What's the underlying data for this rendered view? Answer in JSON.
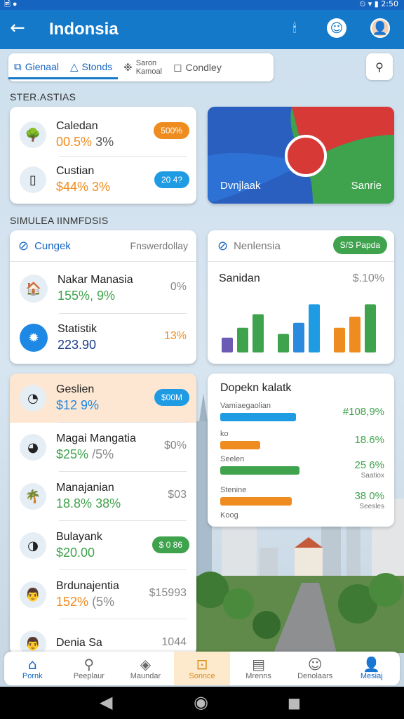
{
  "status": {
    "left": "🖻 ●",
    "right": "⏲ ▾ ▮ 2:50"
  },
  "appbar": {
    "back_icon": "←",
    "title": "Indonsia",
    "battery_icon": "🕯",
    "face_icon": "☺",
    "avatar_icon": "👤"
  },
  "tabs": [
    {
      "icon": "⧉",
      "label": "Gienaal"
    },
    {
      "icon": "△",
      "label": "Stonds"
    },
    {
      "icon": "❉",
      "label_line1": "Saron",
      "label_line2": "Kamoal"
    },
    {
      "icon": "◻",
      "label": "Condley"
    }
  ],
  "search_icon": "⚲",
  "section1": "STER.ASTIAS",
  "stats_card": {
    "rows": [
      {
        "label": "Caledan",
        "value": "00.5%",
        "value2": "3%",
        "badge": "500%",
        "badge_color": "#ef8c1f",
        "icon": "🌳"
      },
      {
        "label": "Custian",
        "value": "$44% 3%",
        "badge": "20 4?",
        "badge_color": "#1e9be3",
        "icon": "▯"
      }
    ]
  },
  "map_card": {
    "left_label": "Dvnjlaak",
    "right_label": "Sanrie",
    "colors": {
      "blue": "#2a5fc0",
      "red": "#d73a36",
      "green": "#3fa34d"
    }
  },
  "section2": "SIMULEA IINMFDSIS",
  "mid_left_card": {
    "header_icon": "⊘",
    "header_label": "Cungek",
    "header_right": "Fnswerdollay",
    "rows": [
      {
        "label": "Nakar Manasia",
        "value": "155%, 9%",
        "right": "0%",
        "icon": "🏠"
      },
      {
        "label": "Statistik",
        "value": "223.90",
        "right": "13%",
        "icon": "✹"
      }
    ]
  },
  "mid_right_card": {
    "header_icon": "⊘",
    "header_label": "Nenlensia",
    "header_pill": "S/S Papda",
    "chart_label": "Sanidan",
    "chart_right": "$.10%"
  },
  "bar_chart": {
    "type": "bar",
    "groups": [
      {
        "values": [
          24,
          40,
          62
        ],
        "colors": [
          "#6b5bb5",
          "#3fa34d",
          "#3fa34d"
        ]
      },
      {
        "values": [
          30,
          48,
          78
        ],
        "colors": [
          "#3fa34d",
          "#2a8ae0",
          "#1e9be3"
        ]
      },
      {
        "values": [
          40,
          58,
          78
        ],
        "colors": [
          "#ef8c1f",
          "#ef8c1f",
          "#3fa34d"
        ]
      }
    ],
    "ylim": [
      0,
      100
    ]
  },
  "list_card": {
    "rows": [
      {
        "label": "Geslien",
        "value": "$12 9%",
        "badge": "$00M",
        "badge_color": "#1e9be3",
        "icon": "◔",
        "highlight": true
      },
      {
        "label": "Magai Mangatia",
        "value": "$25%",
        "value2": "/5%",
        "right": "$0%",
        "icon": "◕"
      },
      {
        "label": "Manajanian",
        "value": "18.8%",
        "value2": "38%",
        "right": "$03",
        "icon": "🌴"
      },
      {
        "label": "Bulayank",
        "value": "$20.00",
        "badge": "$ 0 86",
        "badge_color": "#3fa34d",
        "icon": "◑"
      },
      {
        "label": "Brdunajentia",
        "value": "152%",
        "value2": "(5%",
        "right": "$15993",
        "icon": "👨"
      },
      {
        "label": "Denia Sa",
        "value": "",
        "right": "1044",
        "icon": "👨"
      }
    ]
  },
  "progress_card": {
    "title": "Dopekn kalatk",
    "rows": [
      {
        "label": "Vamiaegaolian",
        "value": "#108,9%",
        "fill": 0.72,
        "color": "#1e9be3"
      },
      {
        "label": "ko",
        "value": "18.6%",
        "fill": 0.38,
        "color": "#ef8c1f"
      },
      {
        "label": "Seelen",
        "value": "25 6%",
        "sub": "Saatiox",
        "fill": 0.75,
        "color": "#3fa34d"
      },
      {
        "label": "Stenine",
        "value": "38 0%",
        "sub": "Seesles",
        "fill": 0.68,
        "color": "#ef8c1f"
      },
      {
        "label": "Koog",
        "value": "",
        "fill": 0,
        "color": "#ef8c1f"
      }
    ]
  },
  "nav": [
    {
      "icon": "⌂",
      "label": "Pornk",
      "active": true
    },
    {
      "icon": "⚲",
      "label": "Peeplaur"
    },
    {
      "icon": "◈",
      "label": "Maundar"
    },
    {
      "icon": "⊡",
      "label": "Sonnce",
      "mid": true
    },
    {
      "icon": "▤",
      "label": "Mrenns"
    },
    {
      "icon": "☺",
      "label": "Denolaars"
    },
    {
      "icon": "👤",
      "label": "Mesiaj",
      "active": true
    }
  ],
  "sysnav": {
    "back": "◀",
    "home": "◉",
    "recent": "■"
  }
}
